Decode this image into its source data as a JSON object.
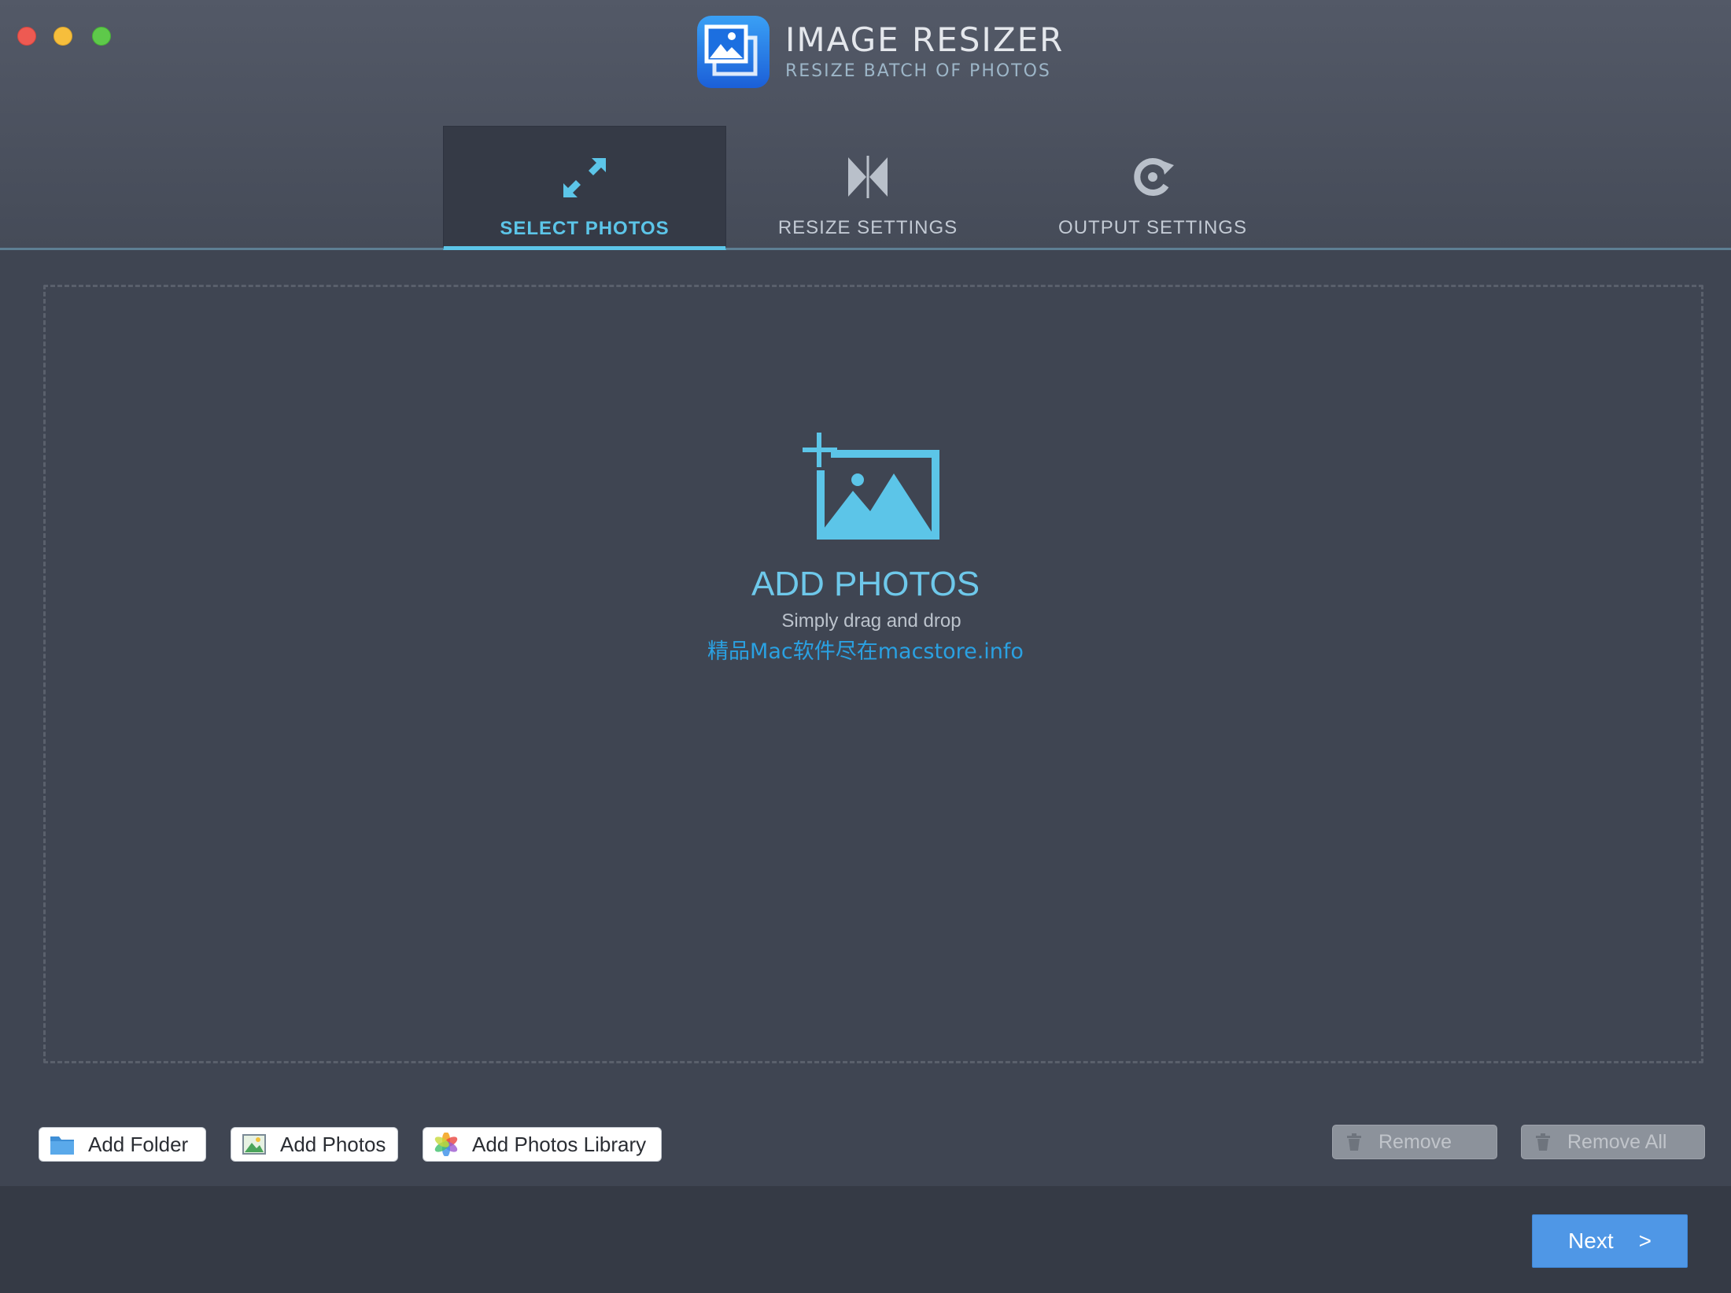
{
  "window": {
    "title": "IMAGE RESIZER",
    "subtitle": "RESIZE BATCH OF PHOTOS",
    "logo_icon": "image-resizer-logo-icon"
  },
  "tabs": [
    {
      "label": "SELECT PHOTOS",
      "icon": "expand-arrows-icon",
      "active": true
    },
    {
      "label": "RESIZE SETTINGS",
      "icon": "bowtie-resize-icon",
      "active": false
    },
    {
      "label": "OUTPUT SETTINGS",
      "icon": "refresh-arrow-icon",
      "active": false
    }
  ],
  "dropzone": {
    "title": "ADD PHOTOS",
    "subtitle": "Simply drag and drop",
    "watermark": "精品Mac软件尽在macstore.info",
    "icon": "add-image-icon"
  },
  "toolbar": {
    "add_folder": "Add Folder",
    "add_photos": "Add Photos",
    "add_photos_library": "Add Photos Library",
    "remove": "Remove",
    "remove_all": "Remove All"
  },
  "footer": {
    "next": "Next",
    "next_arrow": ">"
  },
  "colors": {
    "accent": "#5cc5e8",
    "primary_button": "#4f97e6",
    "background": "#3f4552"
  }
}
